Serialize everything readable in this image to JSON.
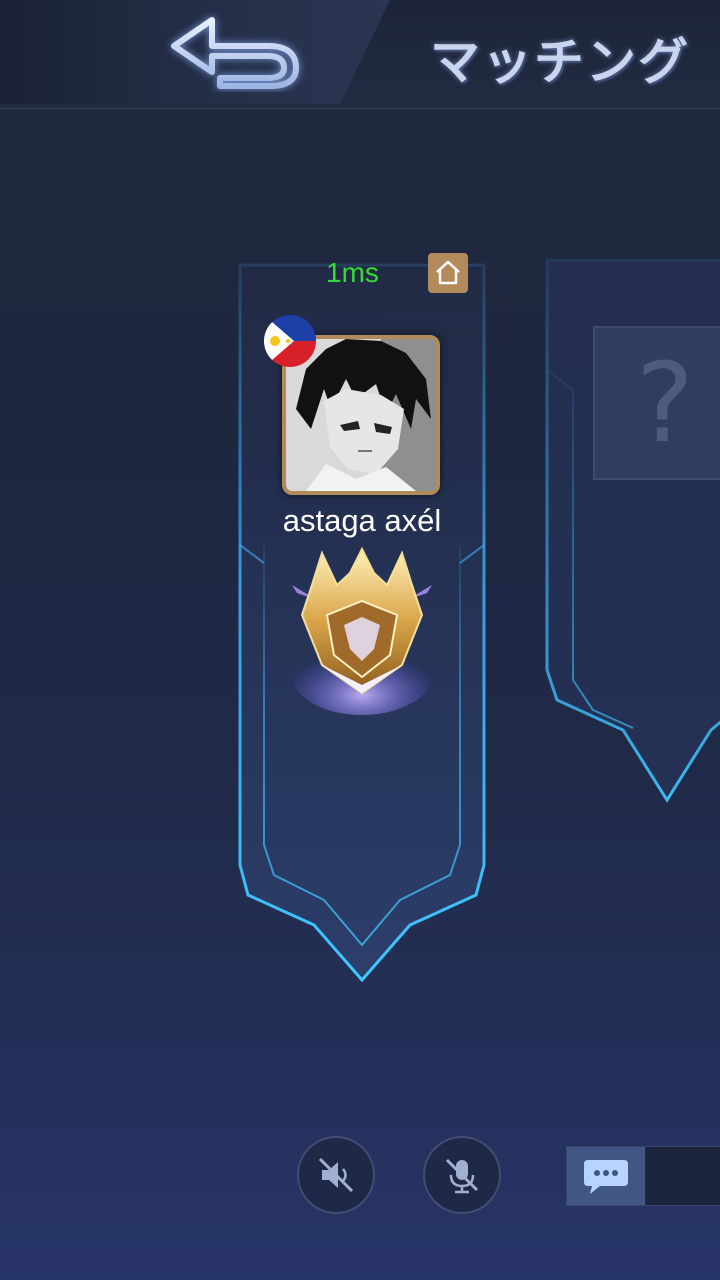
{
  "header": {
    "title": "マッチング",
    "back_icon": "back-arrow-icon"
  },
  "player": {
    "ping": "1ms",
    "ping_color": "#33dd33",
    "home_icon": "home-icon",
    "flag_icon": "philippines-flag-icon",
    "name": "astaga axél",
    "rank_icon": "mythic-rank-emblem-icon"
  },
  "empty_slot": {
    "placeholder": "?"
  },
  "controls": {
    "sound_icon": "speaker-muted-icon",
    "mic_icon": "mic-muted-icon",
    "chat_icon": "chat-bubble-icon"
  },
  "colors": {
    "frame_glow": "#3fb6ff",
    "avatar_border": "#b18b5c",
    "home_badge": "#b38a5c"
  }
}
